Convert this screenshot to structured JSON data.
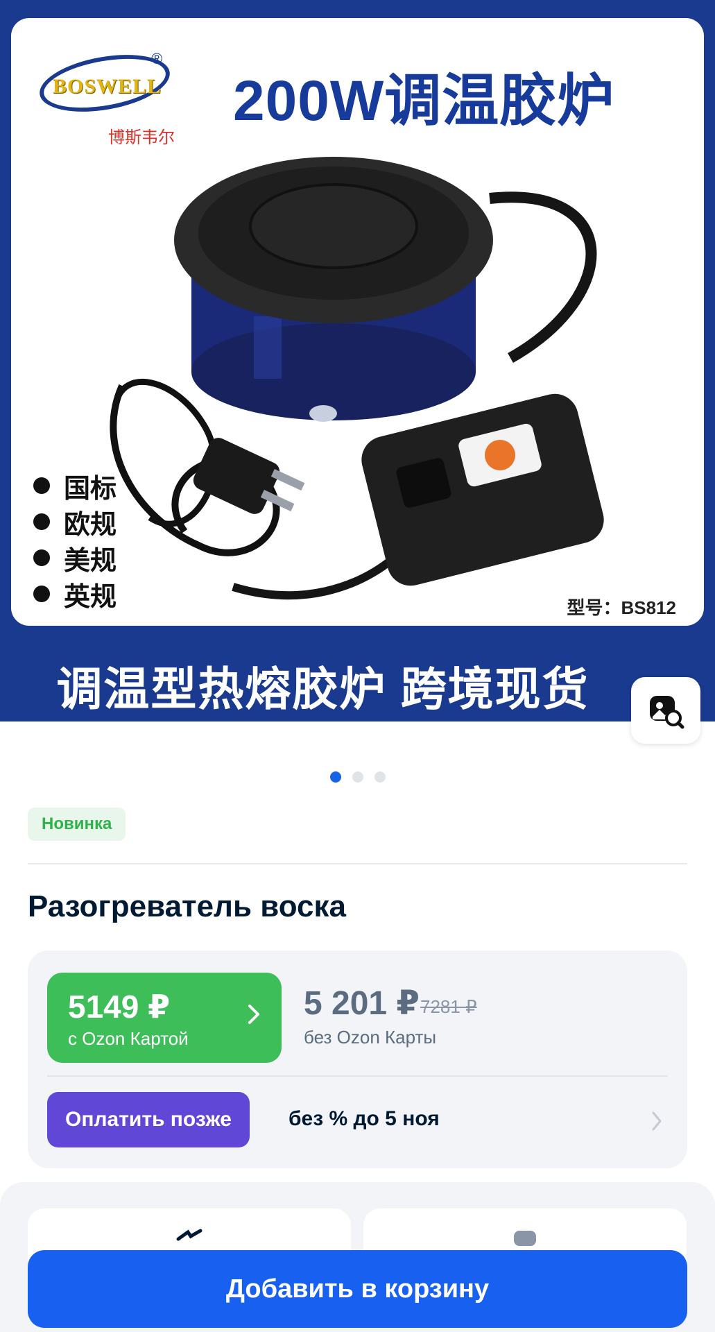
{
  "hero": {
    "brand_logo": "BOSWELL",
    "brand_logo_cn": "博斯韦尔",
    "title": "200W调温胶炉",
    "standards": [
      "国标",
      "欧规",
      "美规",
      "英规"
    ],
    "model": "型号：BS812",
    "subtitle": "调温型热熔胶炉  跨境现货"
  },
  "gallery": {
    "total_images": 3,
    "active_index": 0
  },
  "badge": {
    "label": "Новинка"
  },
  "product": {
    "title": "Разогреватель воска"
  },
  "price": {
    "ozon_card_price": "5149 ₽",
    "ozon_card_caption": "с Ozon Картой",
    "regular_price": "5 201 ₽",
    "old_price": "7281 ₽",
    "regular_caption": "без Ozon Карты",
    "pay_later_label": "Оплатить позже",
    "pay_later_terms": "без % до 5 ноя"
  },
  "actions": {
    "add_to_cart_label": "Добавить в корзину"
  },
  "colors": {
    "hero_blue": "#1a3a8f",
    "ozon_green": "#3dbe58",
    "pay_later_purple": "#6147d6",
    "cart_blue": "#1860f0",
    "badge_green": "#2eb34b"
  },
  "icons": [
    "visual-search-icon",
    "chevron-right-icon",
    "product-photo",
    "brand-logo"
  ]
}
